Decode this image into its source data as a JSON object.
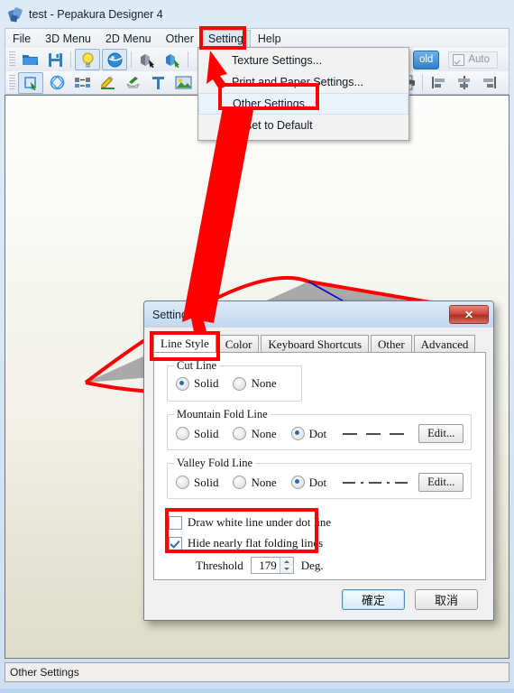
{
  "window": {
    "title": "test - Pepakura Designer 4",
    "app_icon": "pepakura-logo-icon"
  },
  "menubar": {
    "items": [
      {
        "label": "File",
        "open": false
      },
      {
        "label": "3D Menu",
        "open": false
      },
      {
        "label": "2D Menu",
        "open": false
      },
      {
        "label": "Other",
        "open": false
      },
      {
        "label": "Setting",
        "open": true
      },
      {
        "label": "Help",
        "open": false
      }
    ]
  },
  "dropdown": {
    "items": [
      {
        "label": "Texture Settings...",
        "highlighted": false
      },
      {
        "label": "Print and Paper Settings...",
        "highlighted": false
      },
      {
        "label": "Other Settings...",
        "highlighted": true
      },
      {
        "label": "Reset to Default",
        "highlighted": false
      }
    ]
  },
  "toolbar": {
    "row1_icons": [
      "open-folder-icon",
      "save-disk-icon",
      "lightbulb-icon",
      "texture-sphere-icon",
      "rotate-model-icon",
      "select-face-icon",
      "cube-shade-icon"
    ],
    "row2_icons": [
      "move-part-icon",
      "rotate-part-icon",
      "join-split-icon",
      "edit-line-icon",
      "flap-edit-icon",
      "text-tool-icon",
      "image-tool-icon",
      "cube-tool-icon"
    ],
    "right_icons": [
      "print-icon",
      "align-left-icon",
      "align-center-icon",
      "align-right-icon"
    ],
    "unfold_label": "old",
    "auto_label": "Auto",
    "auto_checked": true
  },
  "statusbar": {
    "text": "Other Settings"
  },
  "model": {
    "face_color": "#a9a9a9",
    "outline_color": "#ff0000",
    "fold_line_color": "#0000cc"
  },
  "dialog": {
    "title": "Setting",
    "close_label": "✕",
    "tabs": [
      {
        "label": "Line Style",
        "active": true
      },
      {
        "label": "Color",
        "active": false
      },
      {
        "label": "Keyboard Shortcuts",
        "active": false
      },
      {
        "label": "Other",
        "active": false
      },
      {
        "label": "Advanced",
        "active": false
      }
    ],
    "cut_line": {
      "legend": "Cut Line",
      "options": [
        {
          "label": "Solid",
          "selected": true
        },
        {
          "label": "None",
          "selected": false
        }
      ]
    },
    "mountain_fold": {
      "legend": "Mountain Fold Line",
      "options": [
        {
          "label": "Solid",
          "selected": false
        },
        {
          "label": "None",
          "selected": false
        },
        {
          "label": "Dot",
          "selected": true
        }
      ],
      "preview_pattern": "dashed",
      "edit_label": "Edit..."
    },
    "valley_fold": {
      "legend": "Valley Fold Line",
      "options": [
        {
          "label": "Solid",
          "selected": false
        },
        {
          "label": "None",
          "selected": false
        },
        {
          "label": "Dot",
          "selected": true
        }
      ],
      "preview_pattern": "dash-dot",
      "edit_label": "Edit..."
    },
    "checkboxes": [
      {
        "label": "Draw white line under dot line",
        "checked": false
      },
      {
        "label": "Hide nearly flat folding lines",
        "checked": true
      }
    ],
    "threshold": {
      "label": "Threshold",
      "value": "179",
      "unit": "Deg."
    },
    "buttons": {
      "ok": "確定",
      "cancel": "取消"
    }
  },
  "annotations": {
    "accent_color": "#ff0000",
    "highlight_boxes": [
      "setting-menu-item",
      "other-settings-menu-item",
      "line-style-tab",
      "hide-flat-folding-group"
    ],
    "arrows": [
      "setting-to-menu-arrow",
      "other-settings-to-line-style-tab-arrow"
    ]
  }
}
